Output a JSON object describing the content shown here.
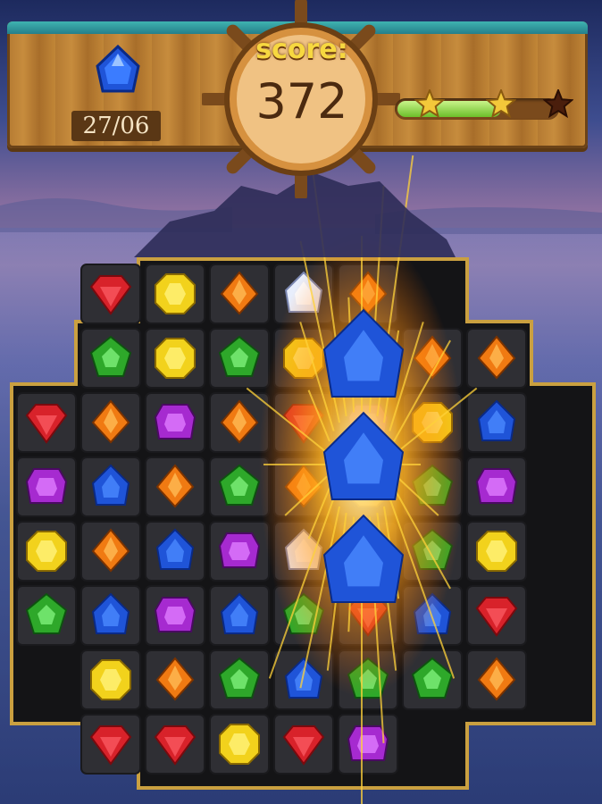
{
  "hud": {
    "score_label": "score:",
    "score_value": "372",
    "moves_text": "27/06",
    "target_gem_icon": "blue-gem-icon",
    "progress_fraction": 0.65,
    "stars_earned": 2,
    "stars_total": 3
  },
  "colors": {
    "red": "#d8222a",
    "yellow": "#f2d21c",
    "orange": "#f07a12",
    "blue": "#1f54d8",
    "green": "#2ea82a",
    "purple": "#a62ad0",
    "white": "#e8eefc",
    "star_gold": "#f3c83a",
    "star_empty": "#4a1e0c"
  },
  "board": {
    "cols": 9,
    "rows": 8,
    "grid": [
      [
        null,
        "red",
        "yellow",
        "orange",
        "white",
        "orange",
        null,
        null,
        null
      ],
      [
        null,
        "green",
        "yellow",
        "green",
        "yellow",
        "green",
        "orange",
        "orange",
        null
      ],
      [
        "red",
        "orange",
        "purple",
        "orange",
        "red",
        "purple",
        "yellow",
        "blue",
        null
      ],
      [
        "purple",
        "blue",
        "orange",
        "green",
        "orange",
        "yellow",
        "green",
        "purple",
        null
      ],
      [
        "yellow",
        "orange",
        "blue",
        "purple",
        "white",
        "yellow",
        "green",
        "yellow",
        null
      ],
      [
        "green",
        "blue",
        "purple",
        "blue",
        "green",
        "red",
        "blue",
        "red",
        null
      ],
      [
        null,
        "yellow",
        "orange",
        "green",
        "blue",
        "green",
        "green",
        "orange",
        null
      ],
      [
        null,
        "red",
        "red",
        "yellow",
        "red",
        "purple",
        null,
        null,
        null
      ]
    ]
  },
  "match_effect": {
    "gem_color": "blue",
    "count": 3
  }
}
